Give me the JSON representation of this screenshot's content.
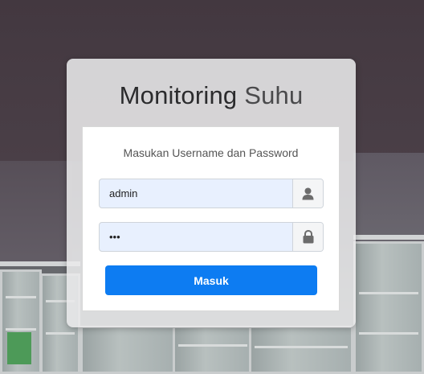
{
  "login": {
    "title_strong": "Monitoring",
    "title_light": "Suhu",
    "subtitle": "Masukan Username dan Password",
    "username": {
      "value": "admin",
      "icon": "user-icon"
    },
    "password": {
      "value": "•••",
      "icon": "lock-icon"
    },
    "submit_label": "Masuk"
  },
  "colors": {
    "button": "#0d7cf2",
    "input_bg": "#e8f0fe"
  }
}
